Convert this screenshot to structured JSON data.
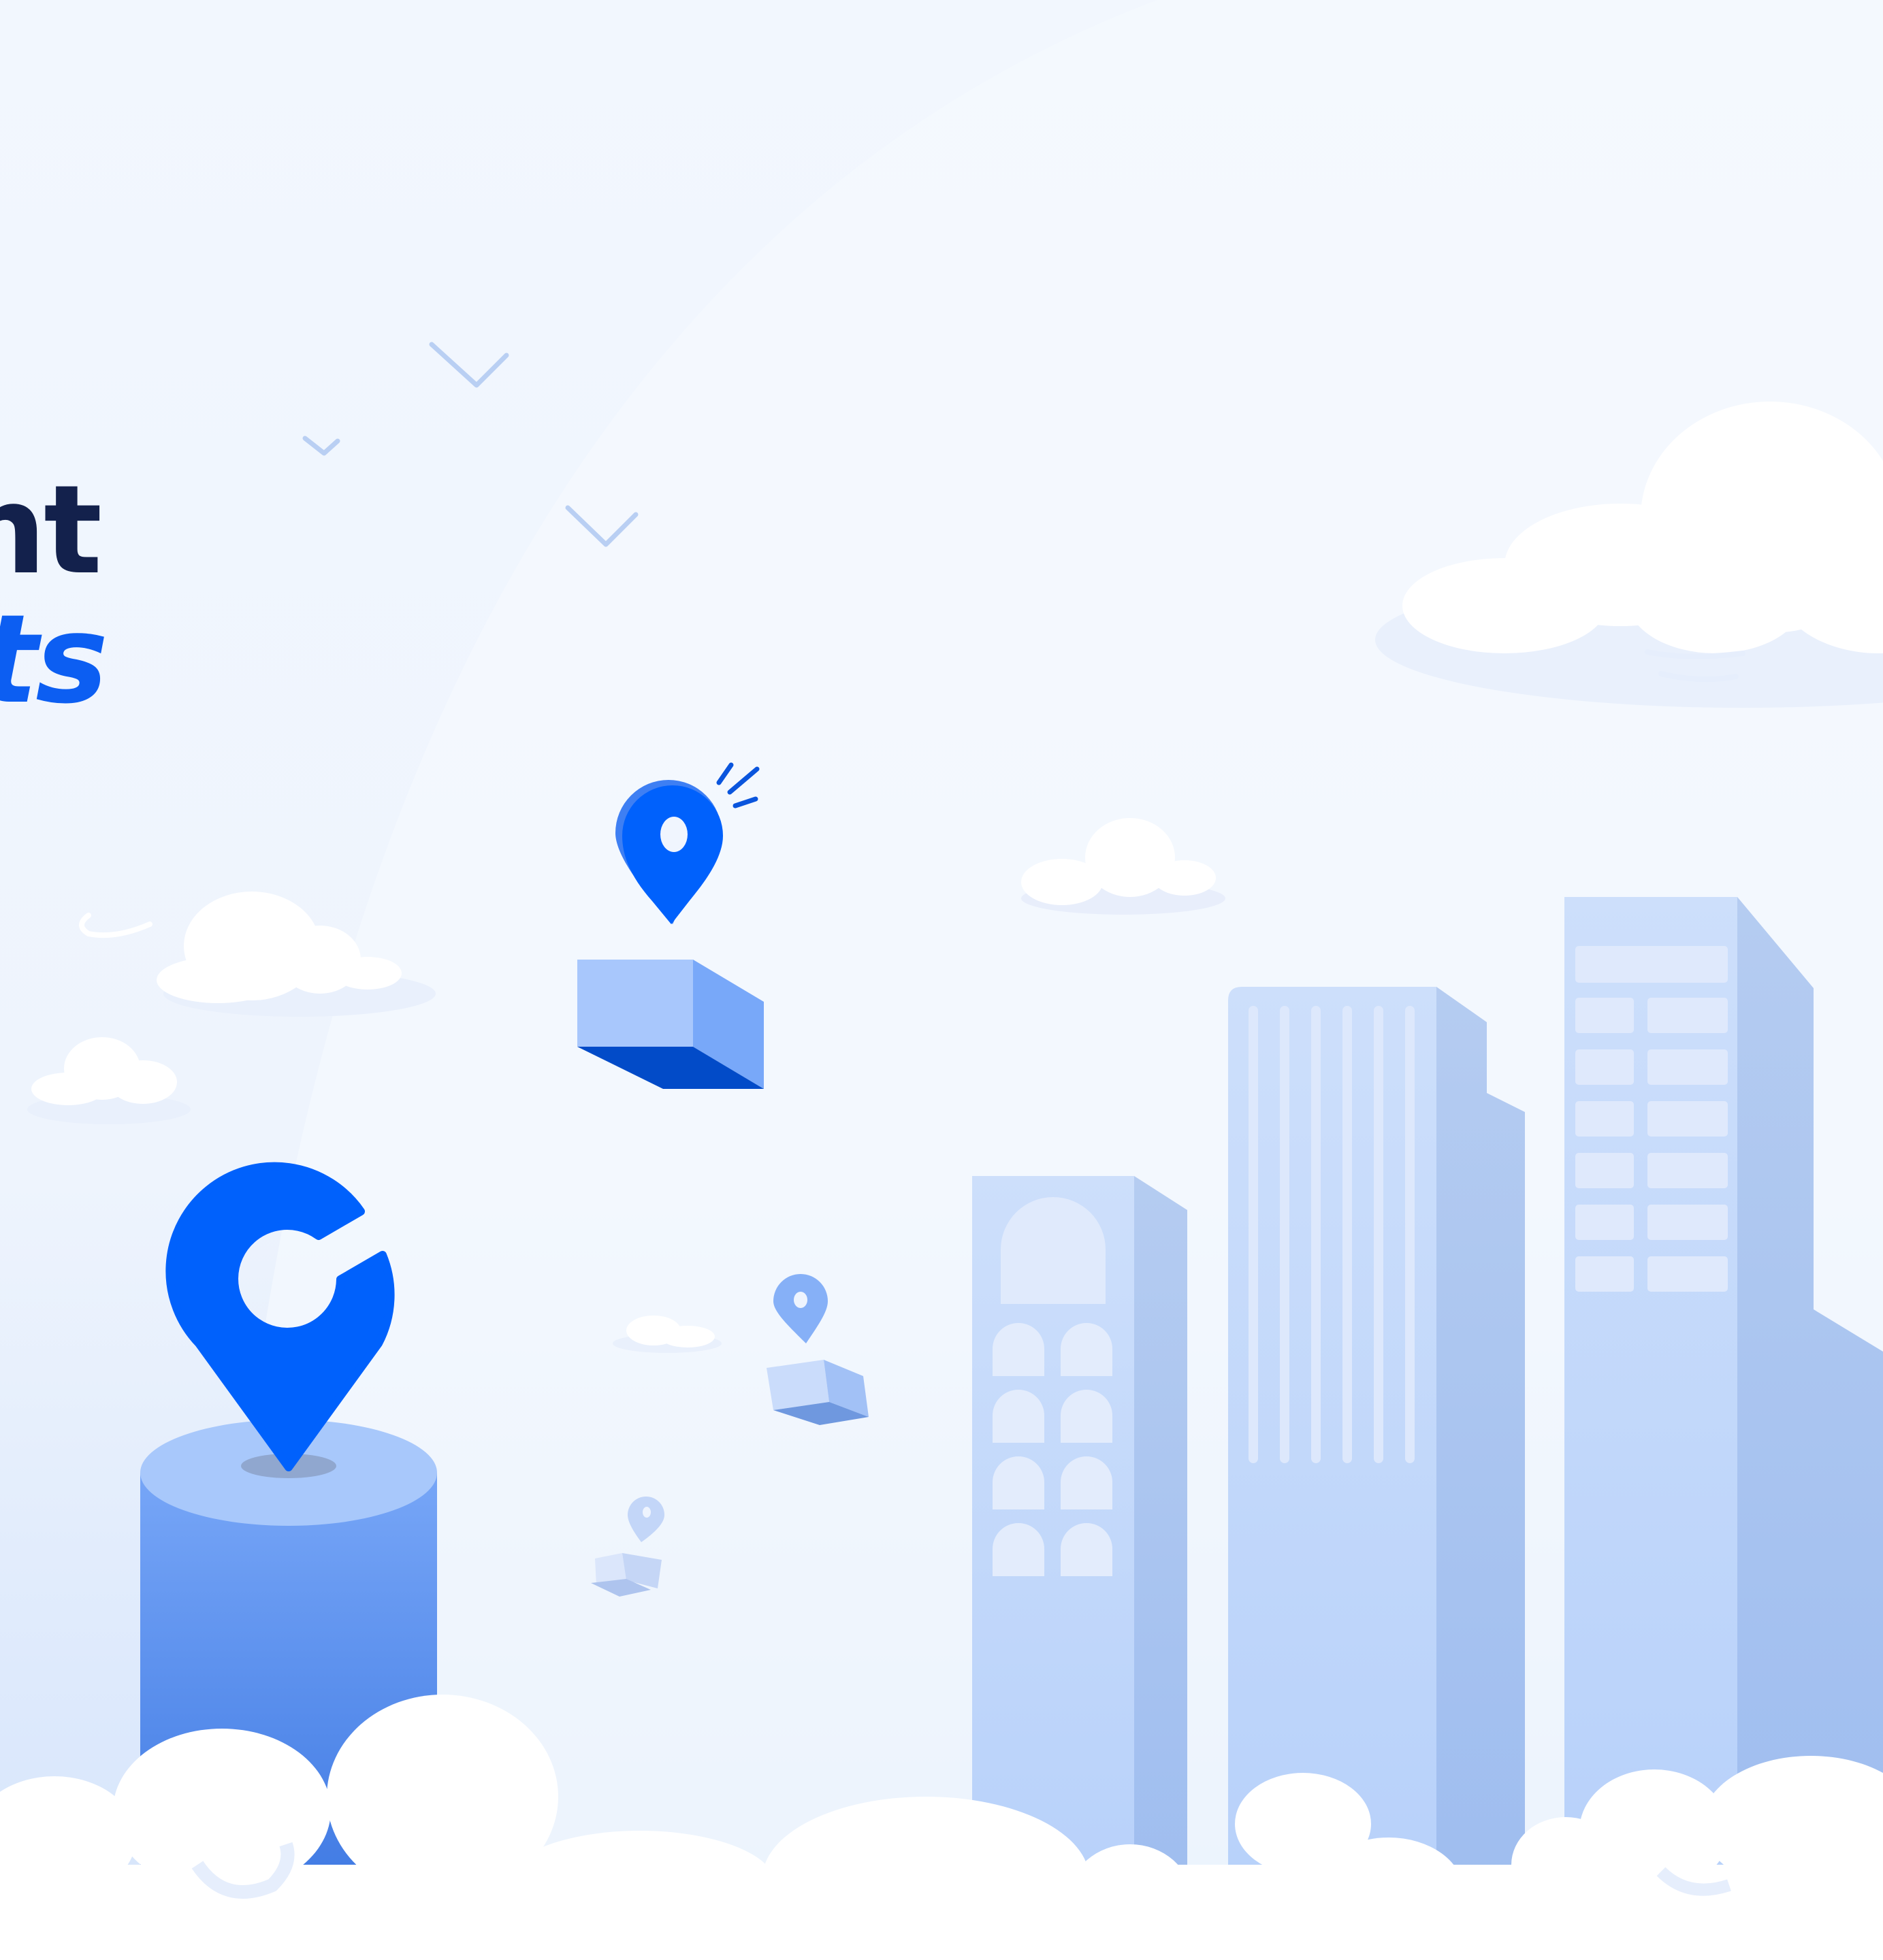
{
  "headline": {
    "line1": "nt",
    "line2": "ts"
  },
  "colors": {
    "background_top": "#f2f7fe",
    "background_bottom": "#d8e6fc",
    "headline_dark": "#13214c",
    "headline_accent": "#0c5ef2",
    "brand_blue": "#0061fc",
    "building_light": "#c6d9fb",
    "building_shade": "#a9c4f1",
    "cloud": "#ffffff",
    "cloud_shadow": "#e6eefc"
  },
  "illustration": {
    "logo_icon": "location-pin-logo-icon",
    "pin_icon": "map-pin-icon",
    "package_icon": "package-box-icon",
    "bird_icon": "bird-icon",
    "cloud_icon": "cloud-icon",
    "building_icon": "building-icon"
  }
}
